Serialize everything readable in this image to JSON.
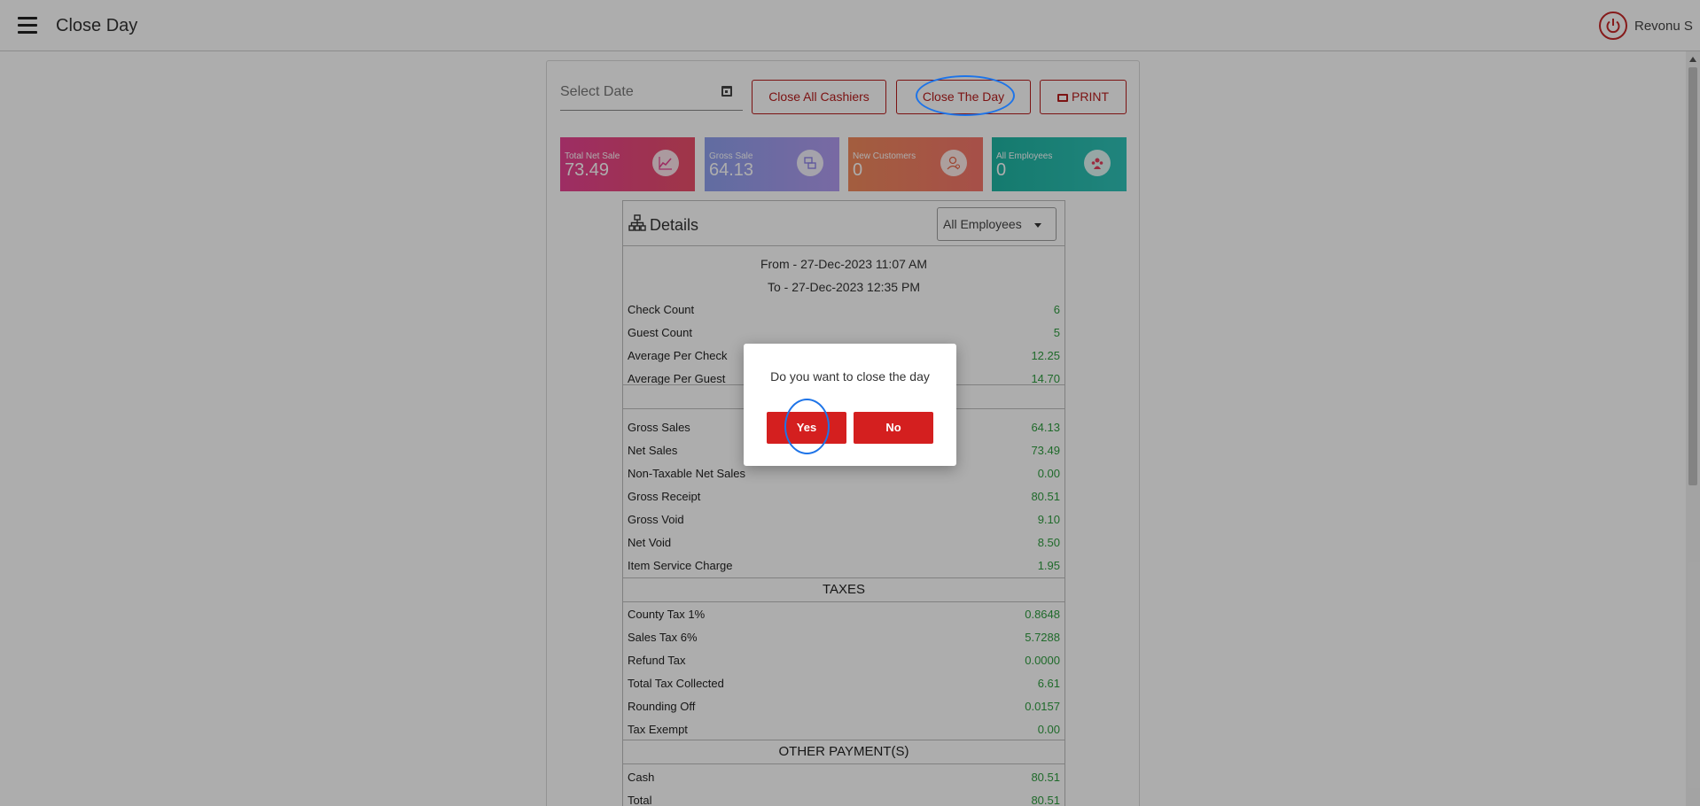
{
  "header": {
    "title": "Close Day",
    "user_name": "Revonu S"
  },
  "toolbar": {
    "date_placeholder": "Select Date",
    "close_all_cashiers": "Close All Cashiers",
    "close_the_day": "Close The Day",
    "print": "PRINT"
  },
  "stats": [
    {
      "label": "Total Net Sale",
      "value": "73.49",
      "icon": "line-chart-icon",
      "color": "#e84393"
    },
    {
      "label": "Gross Sale",
      "value": "64.13",
      "icon": "exchange-icon",
      "color": "#8fa0ee"
    },
    {
      "label": "New Customers",
      "value": "0",
      "icon": "customer-icon",
      "color": "#f08a5d"
    },
    {
      "label": "All Employees",
      "value": "0",
      "icon": "employees-icon",
      "color": "#1fb5a3"
    }
  ],
  "details": {
    "title": "Details",
    "employee_filter": "All Employees",
    "from": "From - 27-Dec-2023 11:07 AM",
    "to": "To - 27-Dec-2023 12:35 PM",
    "summary": [
      {
        "label": "Check Count",
        "value": "6"
      },
      {
        "label": "Guest Count",
        "value": "5"
      },
      {
        "label": "Average Per Check",
        "value": "12.25"
      },
      {
        "label": "Average Per Guest",
        "value": "14.70"
      }
    ],
    "sales": [
      {
        "label": "Gross Sales",
        "value": "64.13"
      },
      {
        "label": "Net Sales",
        "value": "73.49"
      },
      {
        "label": "Non-Taxable Net Sales",
        "value": "0.00"
      },
      {
        "label": "Gross Receipt",
        "value": "80.51"
      },
      {
        "label": "Gross Void",
        "value": "9.10"
      },
      {
        "label": "Net Void",
        "value": "8.50"
      },
      {
        "label": "Item Service Charge",
        "value": "1.95"
      }
    ],
    "taxes_title": "TAXES",
    "taxes": [
      {
        "label": "County Tax 1%",
        "value": "0.8648"
      },
      {
        "label": "Sales Tax 6%",
        "value": "5.7288"
      },
      {
        "label": "Refund Tax",
        "value": "0.0000"
      },
      {
        "label": "Total Tax Collected",
        "value": "6.61"
      },
      {
        "label": "Rounding Off",
        "value": "0.0157"
      },
      {
        "label": "Tax Exempt",
        "value": "0.00"
      }
    ],
    "payments_title": "OTHER PAYMENT(S)",
    "payments": [
      {
        "label": "Cash",
        "value": "80.51"
      },
      {
        "label": "Total",
        "value": "80.51"
      }
    ]
  },
  "dialog": {
    "message": "Do you want to close the day",
    "yes": "Yes",
    "no": "No"
  },
  "colors": {
    "accent_red": "#b71c1c",
    "dialog_button": "#d41f1f",
    "value_green": "#2e9c3f",
    "highlight_blue": "#1e74e8"
  }
}
